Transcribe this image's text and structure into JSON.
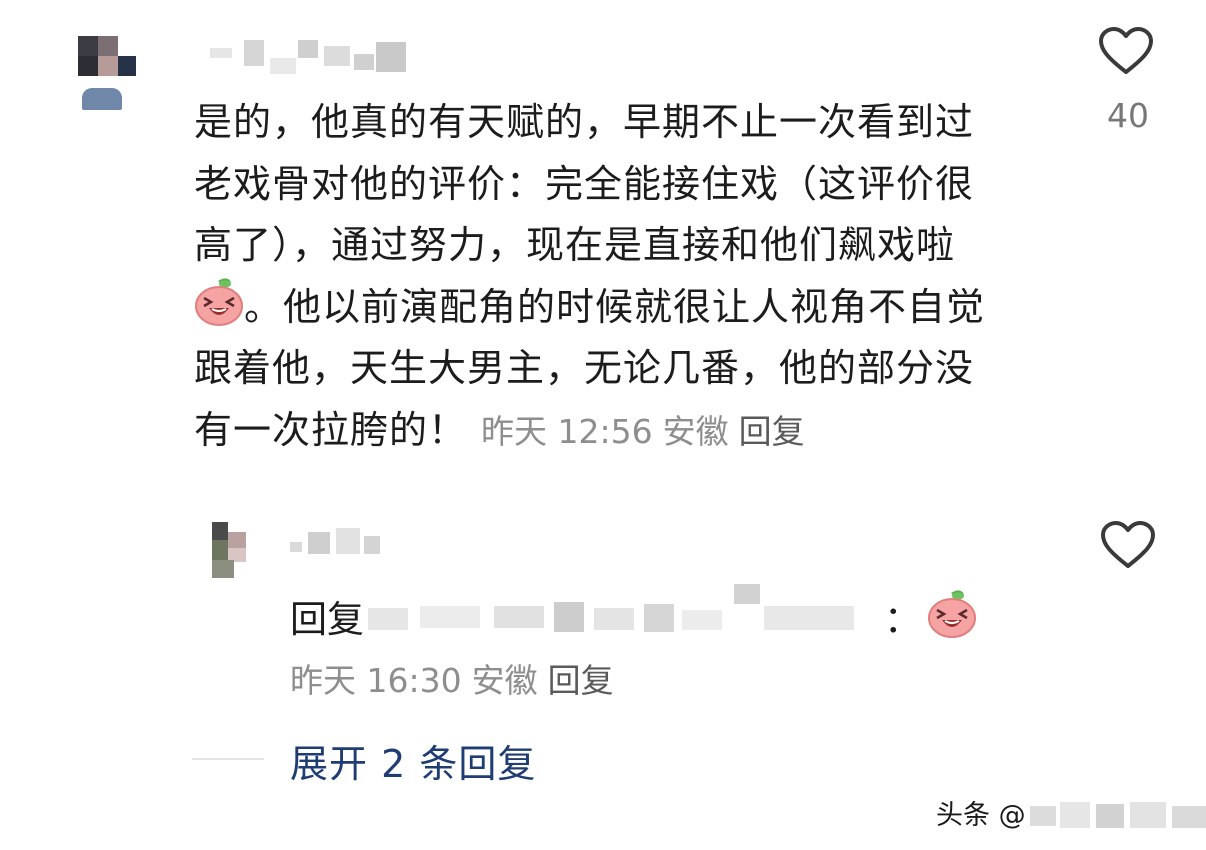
{
  "comment": {
    "lines": [
      "是的，他真的有天赋的，早期不止一次看到过",
      "老戏骨对他的评价：完全能接住戏（这评价很",
      "高了），通过努力，现在是直接和他们飙戏啦",
      "。他以前演配角的时候就很让人视角不自觉",
      "跟着他，天生大男主，无论几番，他的部分没",
      "有一次拉胯的！"
    ],
    "emoji_icon": "laughing-emoji-icon",
    "time": "昨天 12:56",
    "location": "安徽",
    "reply_label": "回复",
    "likes": "40"
  },
  "reply": {
    "prefix": "回复",
    "suffix": "：",
    "emoji_icon": "laughing-emoji-icon",
    "time": "昨天 16:30",
    "location": "安徽",
    "reply_label": "回复"
  },
  "expand_label": "展开 2 条回复",
  "watermark_prefix": "头条 @",
  "colors": {
    "text": "#1c1c1c",
    "meta": "#8e8e8e",
    "link": "#1f3c73",
    "emoji_face": "#f6a3a3"
  }
}
